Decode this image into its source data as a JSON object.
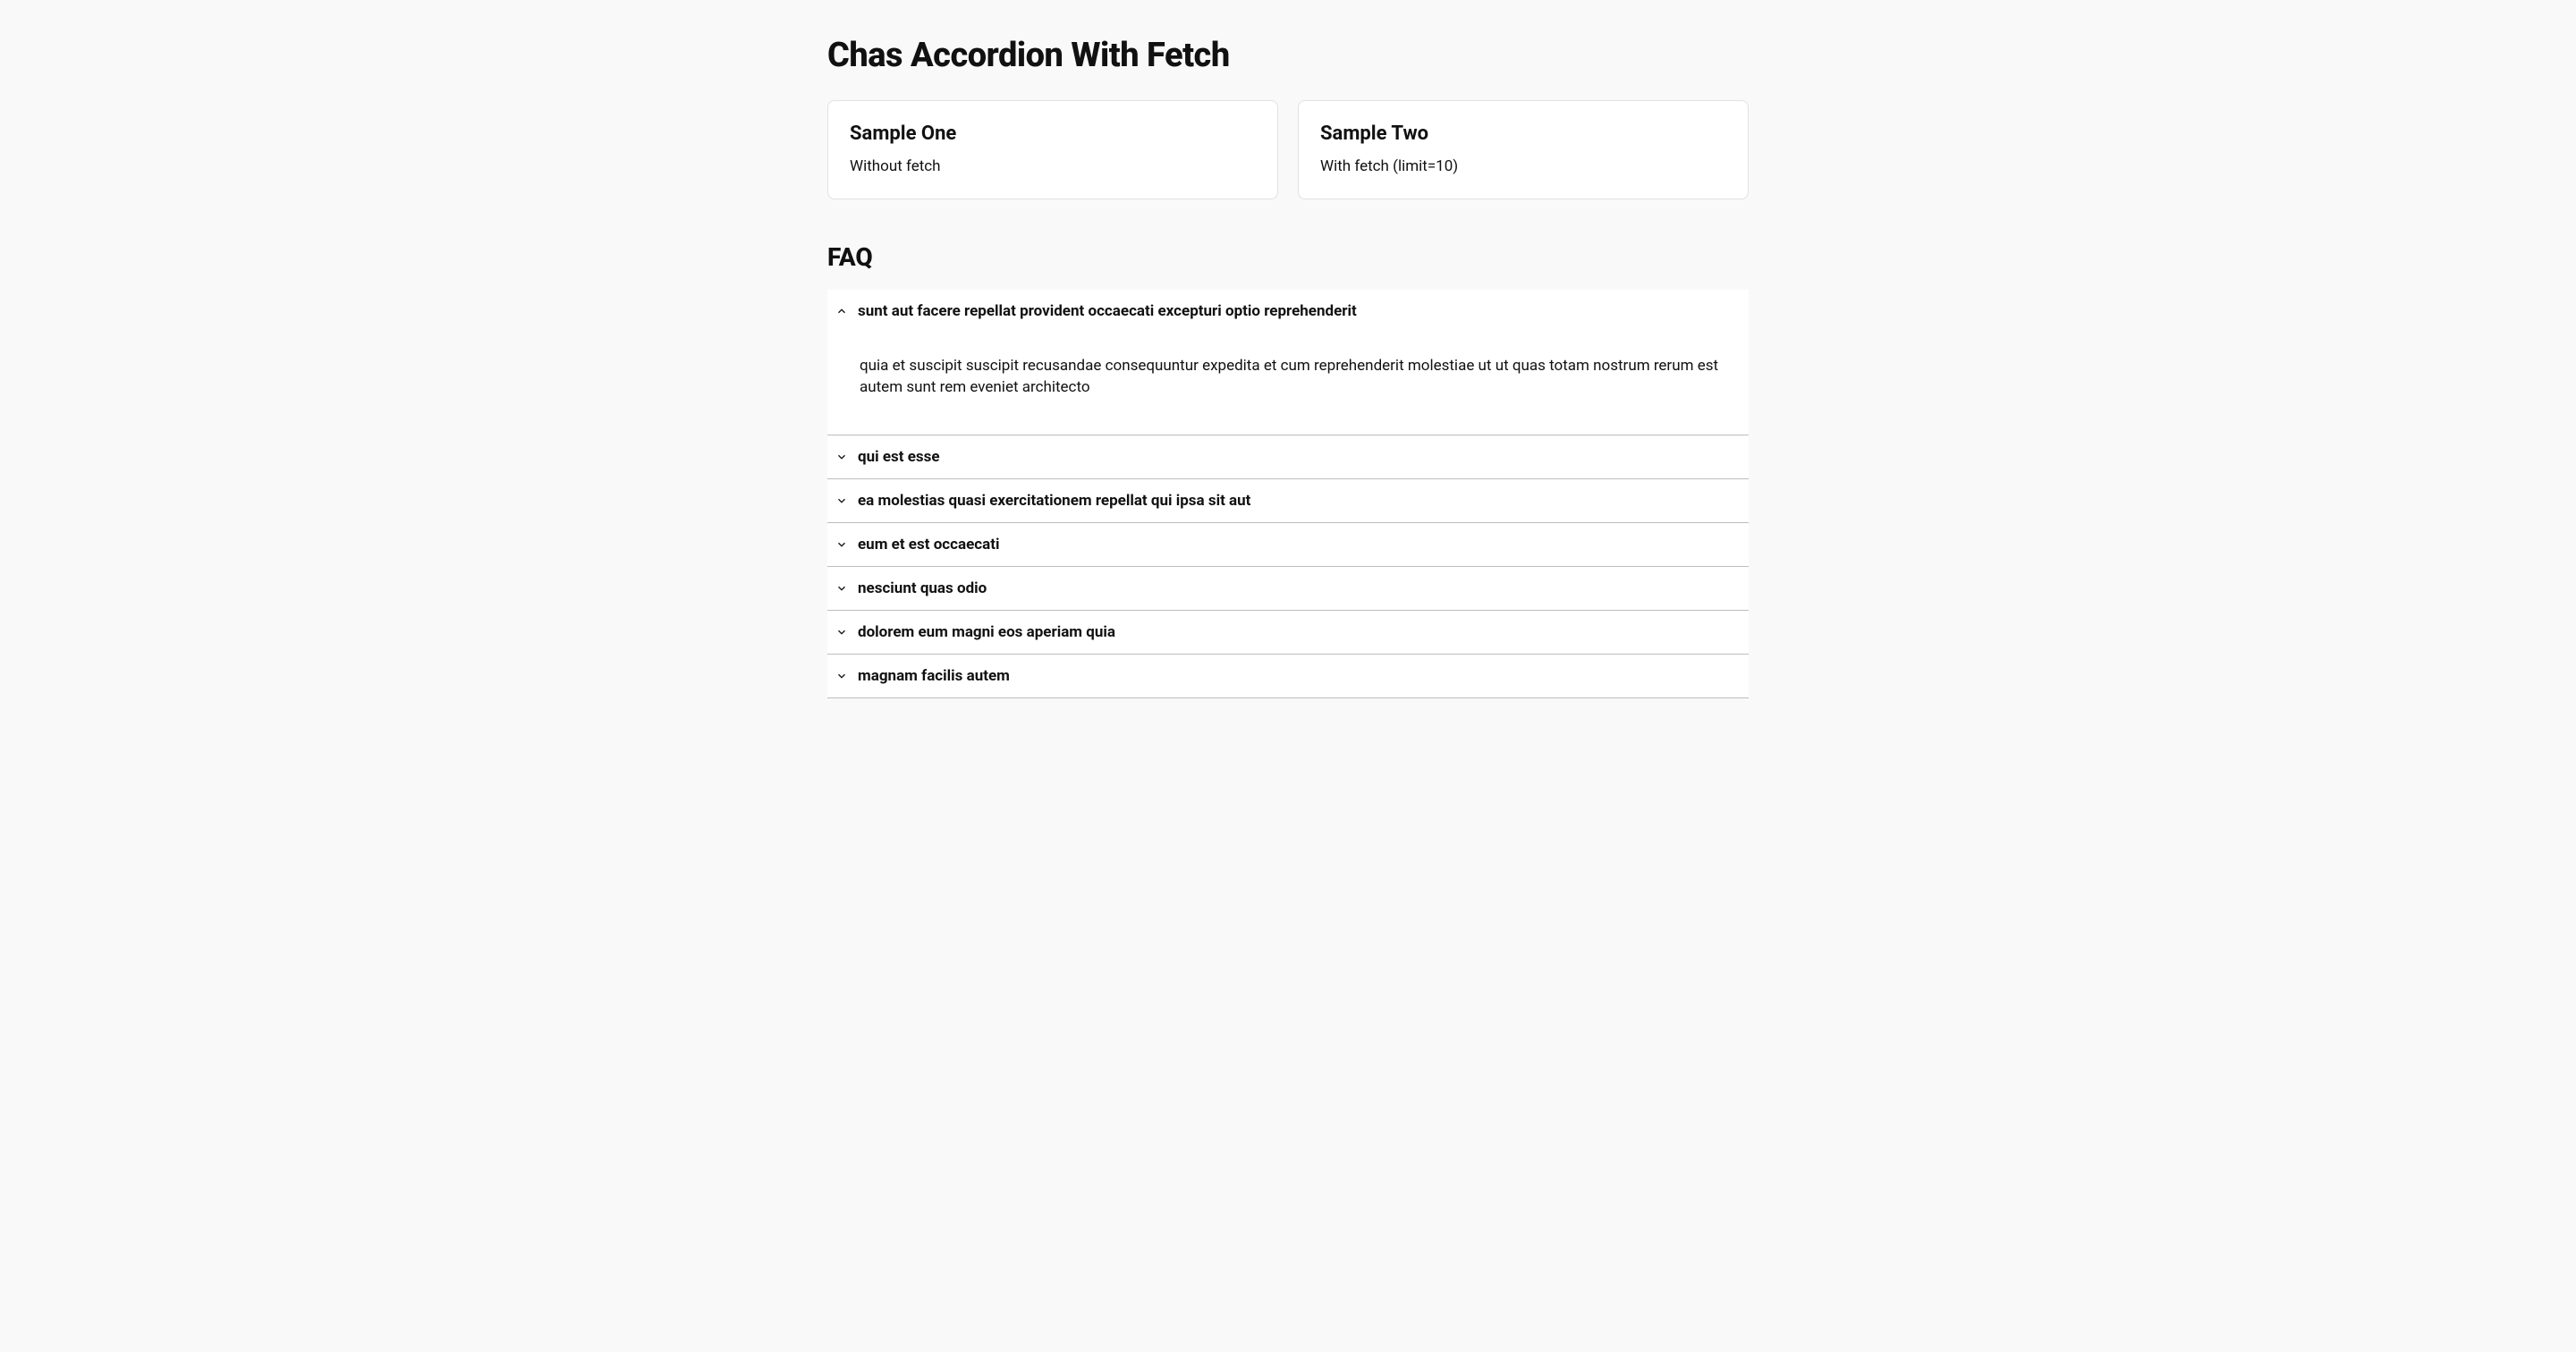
{
  "pageTitle": "Chas Accordion With Fetch",
  "cards": [
    {
      "title": "Sample One",
      "desc": "Without fetch"
    },
    {
      "title": "Sample Two",
      "desc": "With fetch (limit=10)"
    }
  ],
  "faqHeading": "FAQ",
  "faq": [
    {
      "title": "sunt aut facere repellat provident occaecati excepturi optio reprehenderit",
      "body": "quia et suscipit suscipit recusandae consequuntur expedita et cum reprehenderit molestiae ut ut quas totam nostrum rerum est autem sunt rem eveniet architecto",
      "expanded": true
    },
    {
      "title": "qui est esse",
      "body": "",
      "expanded": false
    },
    {
      "title": "ea molestias quasi exercitationem repellat qui ipsa sit aut",
      "body": "",
      "expanded": false
    },
    {
      "title": "eum et est occaecati",
      "body": "",
      "expanded": false
    },
    {
      "title": "nesciunt quas odio",
      "body": "",
      "expanded": false
    },
    {
      "title": "dolorem eum magni eos aperiam quia",
      "body": "",
      "expanded": false
    },
    {
      "title": "magnam facilis autem",
      "body": "",
      "expanded": false
    }
  ]
}
